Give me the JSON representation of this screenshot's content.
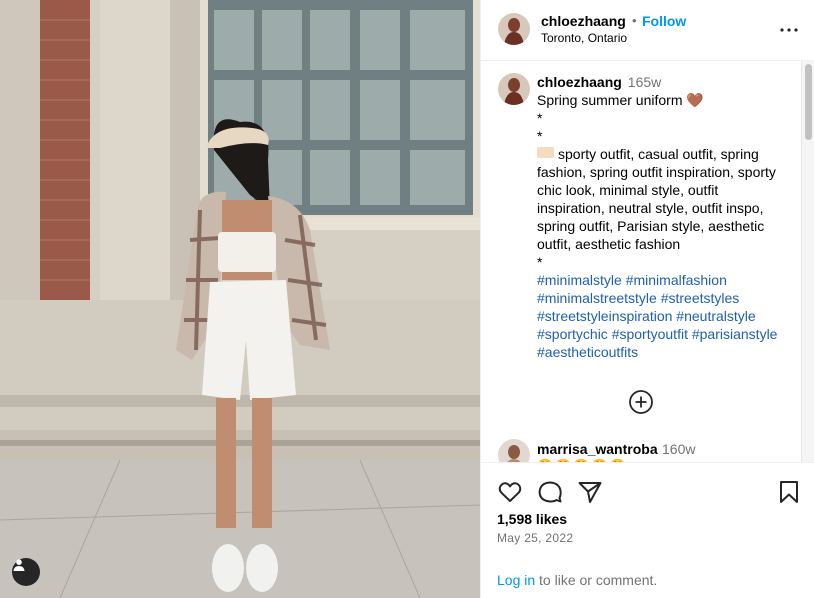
{
  "post": {
    "username": "chloezhaang",
    "dot": "•",
    "follow_label": "Follow",
    "location": "Toronto, Ontario",
    "more_icon": "more-horizontal-icon"
  },
  "caption": {
    "username": "chloezhaang",
    "time": "165w",
    "title": "Spring summer uniform 🤎",
    "sep1": "*",
    "sep2": "*",
    "keywords": "sporty outfit, casual outfit, spring fashion, spring outfit inspiration, sporty chic look, minimal style, outfit inspiration, neutral style, outfit inspo, spring outfit, Parisian style, aesthetic outfit, aesthetic fashion",
    "sep3": "*",
    "hashtags": [
      "#minimalstyle",
      "#minimalfashion",
      "#minimalstreetstyle",
      "#streetstyles",
      "#streetstyleinspiration",
      "#neutralstyle",
      "#sportychic",
      "#sportyoutfit",
      "#parisianstyle",
      "#aestheticoutfits"
    ]
  },
  "comment": {
    "username": "marrisa_wantroba",
    "time": "160w",
    "emojis": "😍😍😍😍😍"
  },
  "actions": {
    "likes": "1,598 likes",
    "date": "May 25, 2022",
    "login_link": "Log in",
    "login_rest": " to like or comment."
  },
  "colors": {
    "link": "#0095f6",
    "hashtag": "#1f5fb0",
    "muted": "#737373"
  }
}
